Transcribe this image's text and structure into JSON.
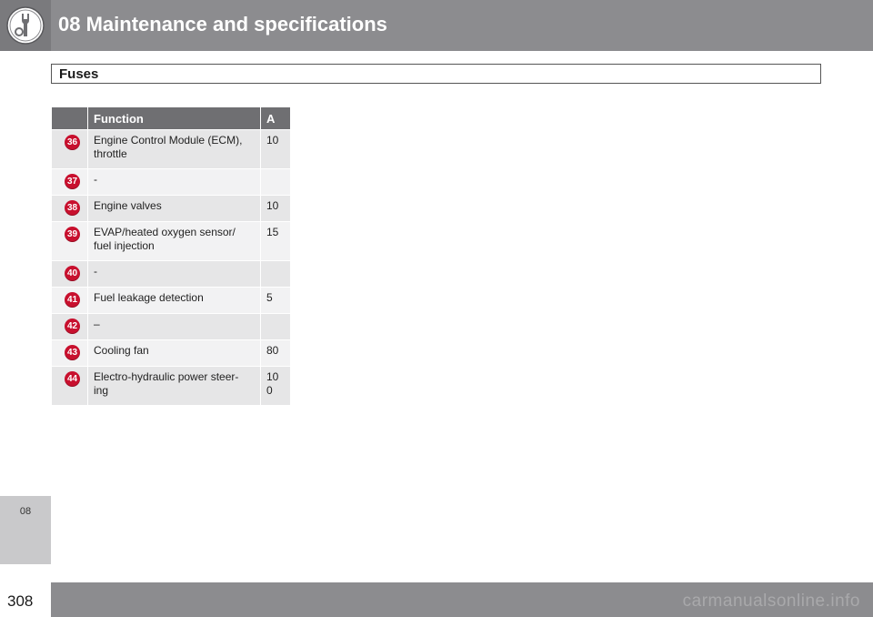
{
  "header": {
    "chapter_title": "08 Maintenance and specifications",
    "icon": "wrench-gear-icon",
    "background_color": "#8c8c8f"
  },
  "section": {
    "title": "Fuses"
  },
  "table": {
    "columns": [
      "",
      "Function",
      "A"
    ],
    "rows": [
      {
        "number": "36",
        "function": "Engine Control Module (ECM), throttle",
        "amps": "10"
      },
      {
        "number": "37",
        "function": "-",
        "amps": ""
      },
      {
        "number": "38",
        "function": "Engine valves",
        "amps": "10"
      },
      {
        "number": "39",
        "function": "EVAP/heated oxygen sensor/ fuel injection",
        "amps": "15"
      },
      {
        "number": "40",
        "function": "-",
        "amps": ""
      },
      {
        "number": "41",
        "function": "Fuel leakage detection",
        "amps": "5"
      },
      {
        "number": "42",
        "function": "–",
        "amps": ""
      },
      {
        "number": "43",
        "function": "Cooling fan",
        "amps": "80"
      },
      {
        "number": "44",
        "function": "Electro-hydraulic power steer- ing",
        "amps": "10 0"
      }
    ],
    "badge_color": "#c8102e"
  },
  "side_tab": {
    "label": "08"
  },
  "footer": {
    "page_number": "308",
    "watermark": "carmanualsonline.info"
  }
}
